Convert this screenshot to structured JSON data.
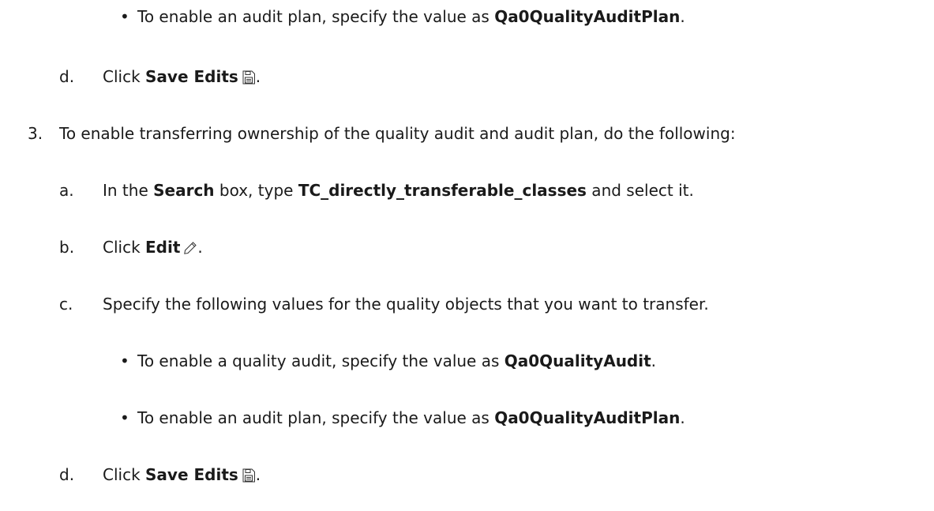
{
  "lines": {
    "l1": {
      "pre": "To enable an audit plan, specify the value as ",
      "bold": "Qa0QualityAuditPlan",
      "post": "."
    },
    "l2": {
      "marker": "d.",
      "pre": "Click ",
      "bold": "Save Edits",
      "post": ".",
      "icon": "save-icon"
    },
    "l3": {
      "marker": "3.",
      "text": "To enable transferring ownership of the quality audit and audit plan, do the following:"
    },
    "l4": {
      "marker": "a.",
      "pre": "In the ",
      "bold1": "Search",
      "mid": " box, type ",
      "bold2": "TC_directly_transferable_classes",
      "post": " and select it."
    },
    "l5": {
      "marker": "b.",
      "pre": "Click ",
      "bold": "Edit",
      "post": ".",
      "icon": "pencil-icon"
    },
    "l6": {
      "marker": "c.",
      "text": "Specify the following values for the quality objects that you want to transfer."
    },
    "l7": {
      "pre": "To enable a quality audit, specify the value as ",
      "bold": "Qa0QualityAudit",
      "post": "."
    },
    "l8": {
      "pre": "To enable an audit plan, specify the value as ",
      "bold": "Qa0QualityAuditPlan",
      "post": "."
    },
    "l9": {
      "marker": "d.",
      "pre": "Click ",
      "bold": "Save Edits",
      "post": ".",
      "icon": "save-icon"
    }
  },
  "bullet_glyph": "•"
}
